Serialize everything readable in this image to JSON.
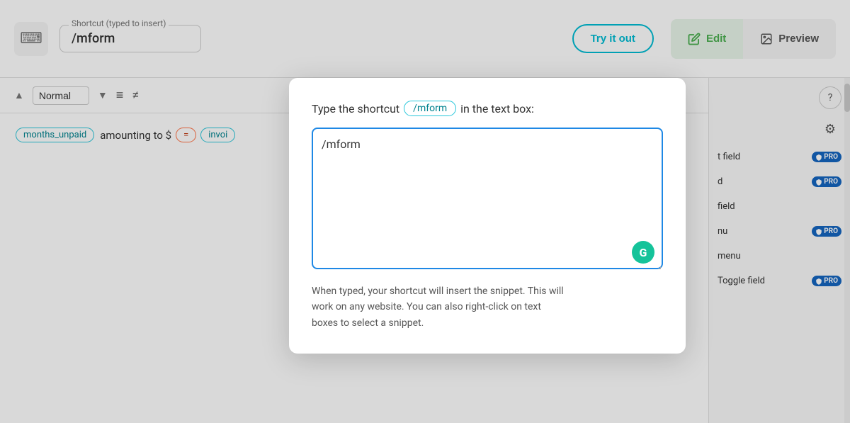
{
  "topBar": {
    "shortcut_label": "Shortcut (typed to insert)",
    "shortcut_value": "/mform",
    "try_it_out_label": "Try it out"
  },
  "tabs": {
    "edit_label": "Edit",
    "preview_label": "Preview"
  },
  "toolbar": {
    "select_option": "Normal",
    "icon_list_label": "list",
    "icon_bullets_label": "bullets"
  },
  "content": {
    "pill1": "months_unpaid",
    "text1": "amounting to $",
    "pill2": "=",
    "pill3": "invoi"
  },
  "sidebar": {
    "question_label": "?",
    "items": [
      {
        "label": "t field",
        "pro": true
      },
      {
        "label": "d",
        "pro": true
      },
      {
        "label": "field",
        "pro": false
      },
      {
        "label": "nu",
        "pro": true
      },
      {
        "label": "menu",
        "pro": false
      },
      {
        "label": "Toggle field",
        "pro": true
      }
    ]
  },
  "modal": {
    "title_prefix": "Type the shortcut",
    "shortcut_pill": "/mform",
    "title_suffix": "in the text box:",
    "textarea_value": "/mform",
    "grammarly_initial": "G",
    "hint_line1": "When typed, your shortcut will insert the snippet. This will",
    "hint_line2": "work on any website. You can also right-click on text",
    "hint_line3": "boxes to select a snippet."
  }
}
